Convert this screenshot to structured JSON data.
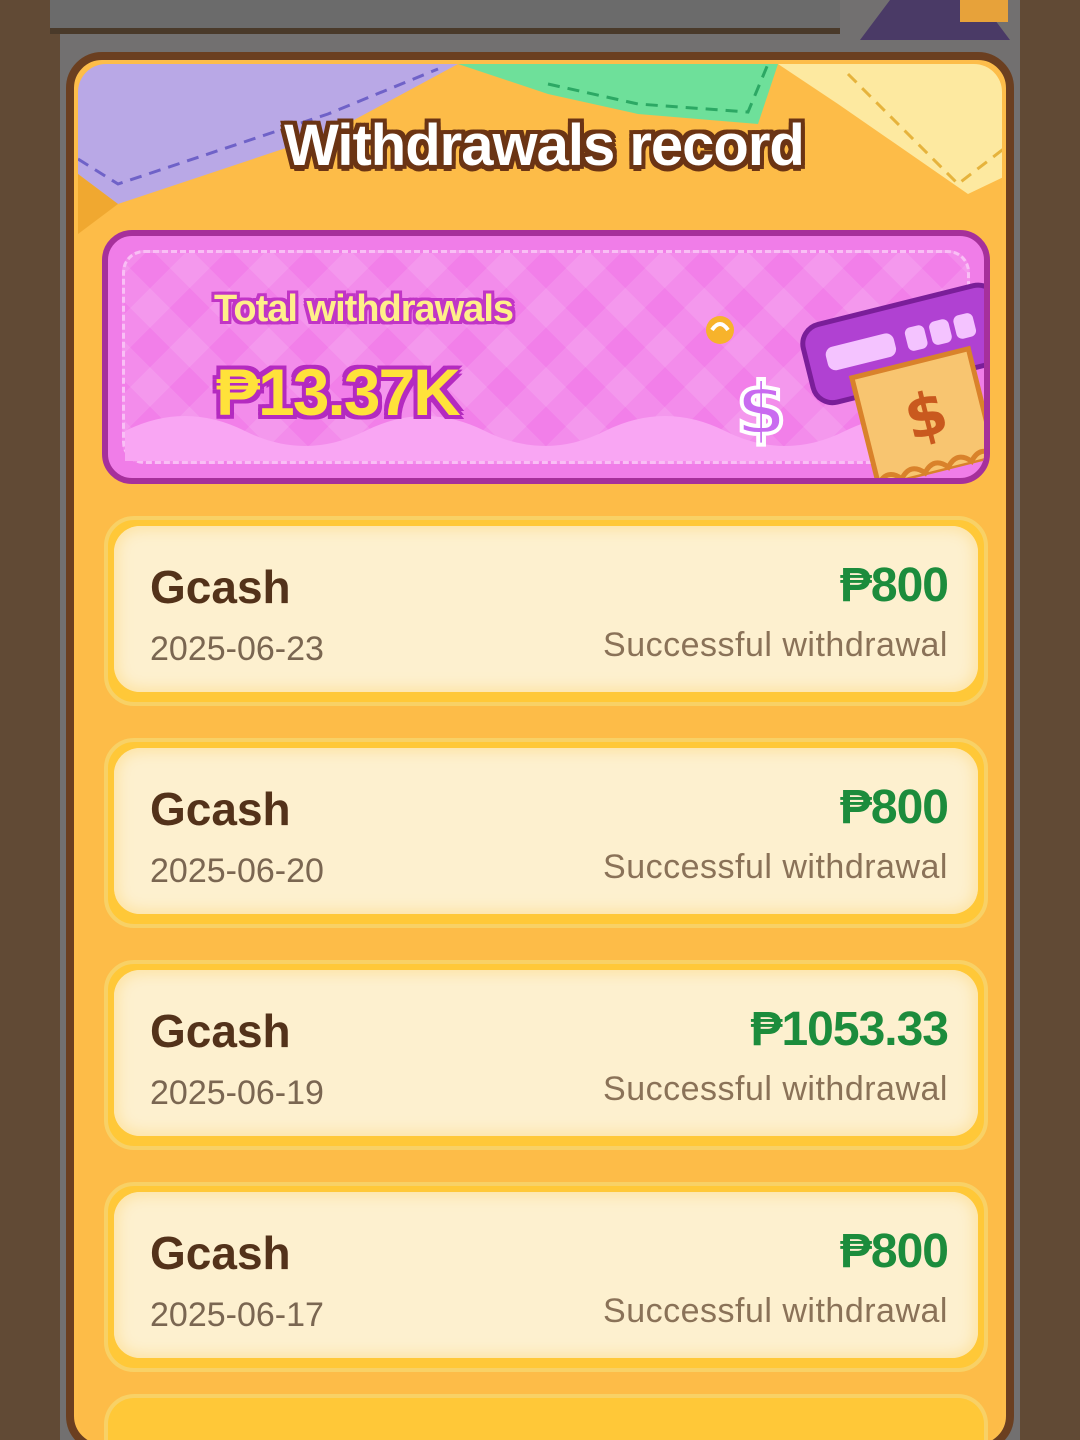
{
  "dialog": {
    "title": "Withdrawals record"
  },
  "summary": {
    "label": "Total withdrawals",
    "amount": "₱13.37K"
  },
  "records": [
    {
      "method": "Gcash",
      "date": "2025-06-23",
      "amount": "₱800",
      "status": "Successful withdrawal"
    },
    {
      "method": "Gcash",
      "date": "2025-06-20",
      "amount": "₱800",
      "status": "Successful withdrawal"
    },
    {
      "method": "Gcash",
      "date": "2025-06-19",
      "amount": "₱1053.33",
      "status": "Successful withdrawal"
    },
    {
      "method": "Gcash",
      "date": "2025-06-17",
      "amount": "₱800",
      "status": "Successful withdrawal"
    }
  ],
  "icons": [
    "atm-dollar-icon",
    "dollar-sign-icon",
    "exchange-icon"
  ],
  "colors": {
    "panel": "#fdbc48",
    "panel_border": "#6b3f20",
    "summary_card": "#f07de8",
    "amount_green": "#1c8c3c",
    "record_bg": "#fdf0cf"
  }
}
